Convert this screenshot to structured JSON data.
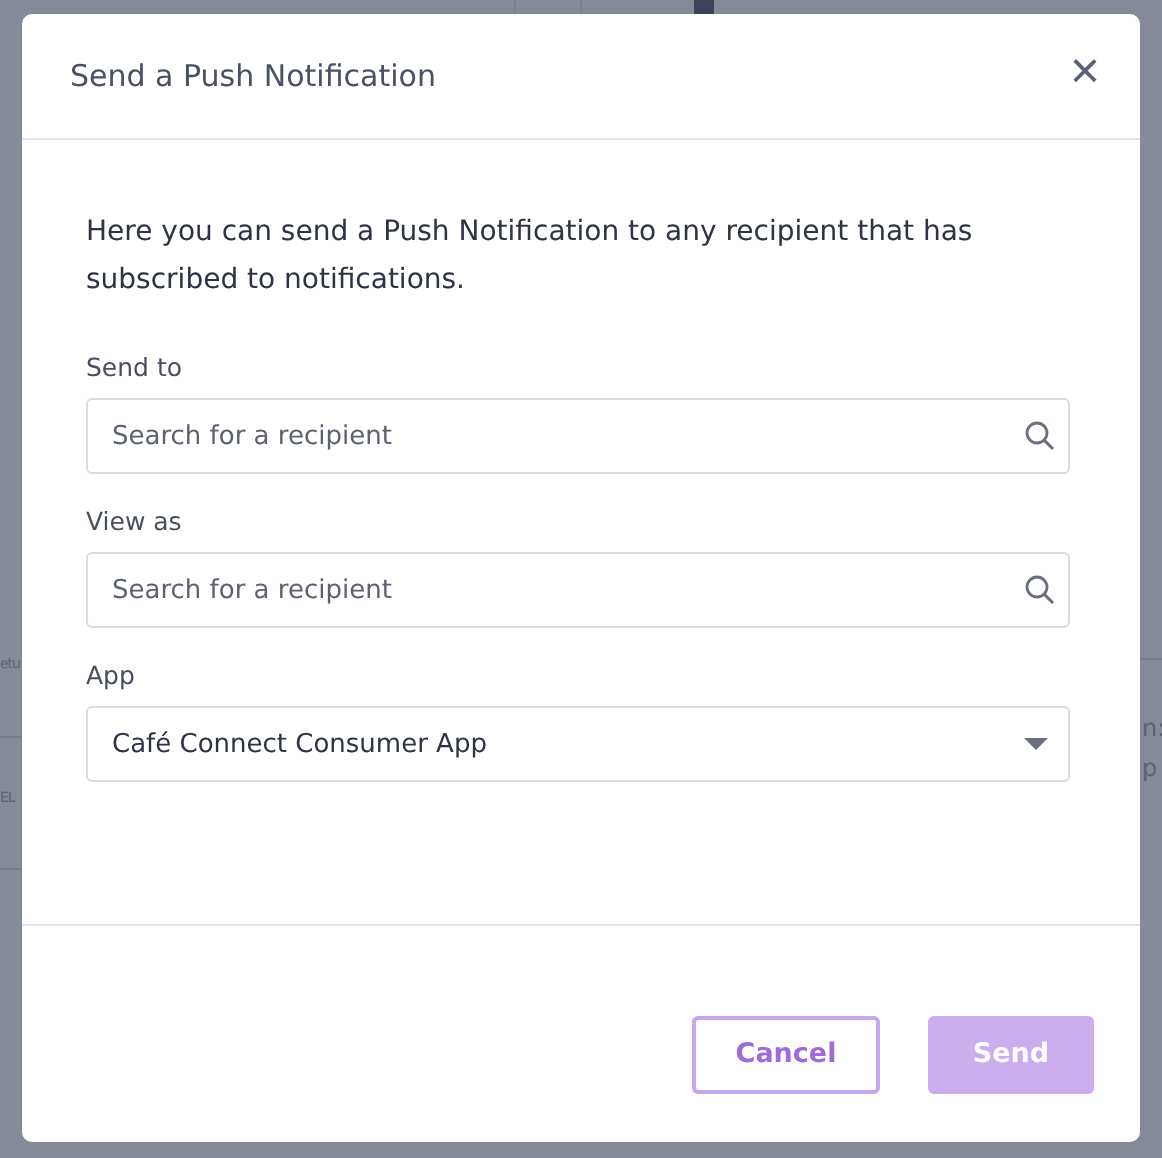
{
  "background": {
    "left_texts": [
      "etu",
      "EL"
    ],
    "right_texts": [
      "n:",
      "p"
    ]
  },
  "dialog": {
    "title": "Send a Push Notification",
    "close": "×",
    "intro": "Here you can send a Push Notification to any recipient that has subscribed to notifications.",
    "fields": [
      {
        "kind": "search",
        "label": "Send to",
        "placeholder": "Search for a recipient"
      },
      {
        "kind": "search",
        "label": "View as",
        "placeholder": "Search for a recipient"
      },
      {
        "kind": "select",
        "label": "App",
        "value": "Café Connect Consumer App"
      }
    ],
    "buttons": [
      {
        "label": "Cancel",
        "kind": "secondary",
        "disabled": false
      },
      {
        "label": "Send",
        "kind": "primary",
        "disabled": true
      }
    ]
  }
}
